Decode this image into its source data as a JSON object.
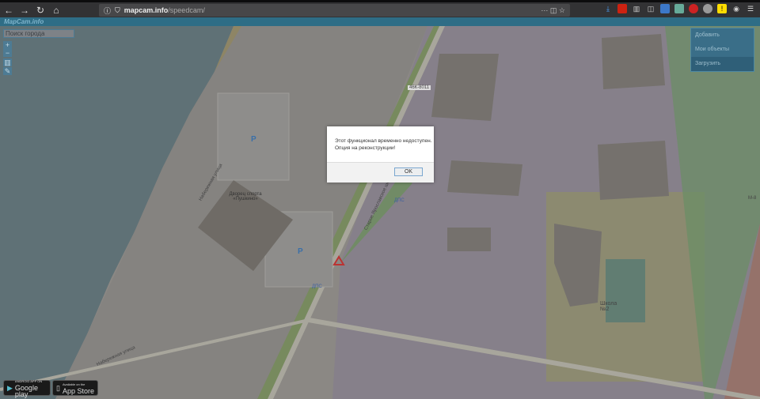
{
  "browser": {
    "url_host": "mapcam.info",
    "url_path": "/speedcam/"
  },
  "site": {
    "title": "MapCam.info"
  },
  "search": {
    "placeholder": "Поиск города"
  },
  "controls": {
    "zoom_in": "+",
    "zoom_out": "−"
  },
  "menu": {
    "items": [
      "Добавить",
      "Мои объекты",
      "Загрузить"
    ]
  },
  "map_labels": {
    "road": "46К-8011",
    "palace": "Дворец спорта «Пушкино»",
    "school": "Школа №2",
    "highway": "М-8",
    "street": "Набережная улица",
    "street2": "Старое Ярославское шоссе",
    "dps": "ДПС",
    "parking": "P"
  },
  "dialog": {
    "line1": "Этот функционал временно недоступен.",
    "line2": "Опция на реконструкции!",
    "ok": "OK"
  },
  "badges": {
    "google_small": "ANDROID APP ON",
    "google": "Google play",
    "apple_small": "Available on the",
    "apple": "App Store"
  }
}
